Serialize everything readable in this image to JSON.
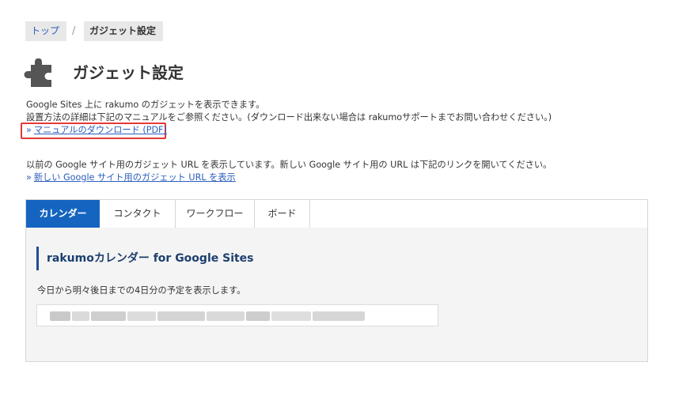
{
  "breadcrumb": {
    "home": "トップ",
    "separator": "/",
    "current": "ガジェット設定"
  },
  "page": {
    "title": "ガジェット設定",
    "icon": "puzzle-piece-icon"
  },
  "intro": {
    "line1": "Google Sites 上に rakumo のガジェットを表示できます。",
    "line2": "設置方法の詳細は下記のマニュアルをご参照ください。(ダウンロード出来ない場合は rakumoサポートまでお問い合わせください。)",
    "bullet": "»",
    "manual_link": "マニュアルのダウンロード (PDF)"
  },
  "legacy": {
    "line": "以前の Google サイト用のガジェット URL を表示しています。新しい Google サイト用の URL は下記のリンクを開いてください。",
    "bullet": "»",
    "new_url_link": "新しい Google サイト用のガジェット URL を表示"
  },
  "tabs": [
    {
      "label": "カレンダー",
      "active": true
    },
    {
      "label": "コンタクト",
      "active": false
    },
    {
      "label": "ワークフロー",
      "active": false
    },
    {
      "label": "ボード",
      "active": false
    }
  ],
  "panel": {
    "heading": "rakumoカレンダー for Google Sites",
    "description": "今日から明々後日までの4日分の予定を表示します。"
  },
  "colors": {
    "accent": "#1565c0",
    "link": "#2a5dbd",
    "highlight_border": "#e53935",
    "heading_bar": "#1d4f91"
  }
}
